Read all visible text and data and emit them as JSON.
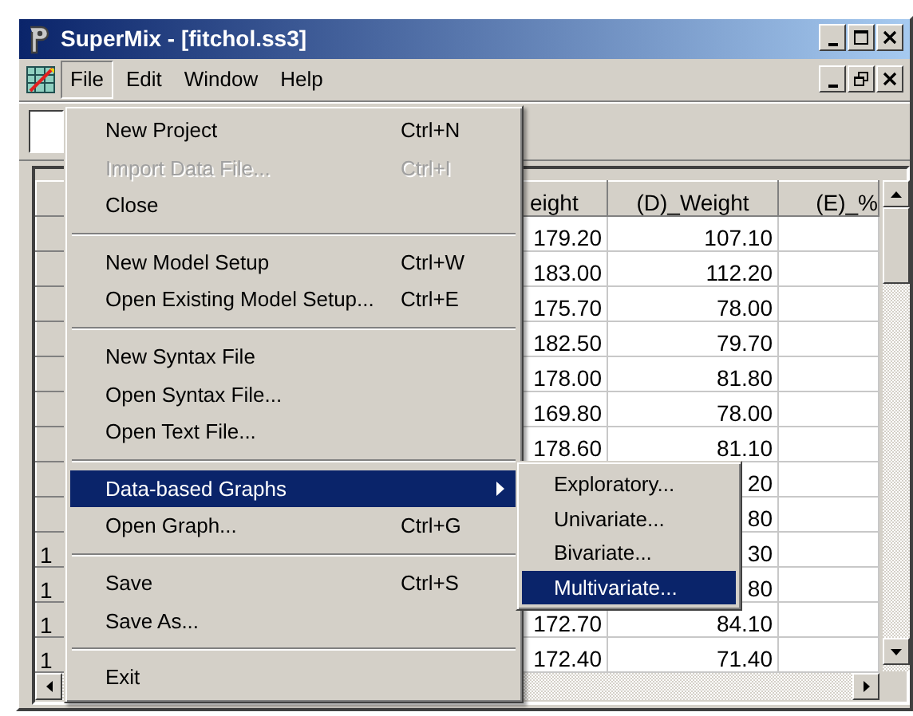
{
  "window": {
    "title": "SuperMix - [fitchol.ss3]"
  },
  "menu_bar": [
    {
      "label": "File",
      "selected": true
    },
    {
      "label": "Edit",
      "selected": false
    },
    {
      "label": "Window",
      "selected": false
    },
    {
      "label": "Help",
      "selected": false
    }
  ],
  "grid": {
    "columns": [
      "eight",
      "(D)_Weight",
      "(E)_%"
    ],
    "rows": [
      {
        "header": "",
        "cells": [
          "179.20",
          "107.10",
          ""
        ]
      },
      {
        "header": "",
        "cells": [
          "183.00",
          "112.20",
          ""
        ]
      },
      {
        "header": "",
        "cells": [
          "175.70",
          "78.00",
          ""
        ]
      },
      {
        "header": "",
        "cells": [
          "182.50",
          "79.70",
          ""
        ]
      },
      {
        "header": "",
        "cells": [
          "178.00",
          "81.80",
          ""
        ]
      },
      {
        "header": "",
        "cells": [
          "169.80",
          "78.00",
          ""
        ]
      },
      {
        "header": "",
        "cells": [
          "178.60",
          "81.10",
          ""
        ]
      },
      {
        "header": "",
        "cells": [
          "",
          "20",
          ""
        ]
      },
      {
        "header": "",
        "cells": [
          "",
          "80",
          ""
        ]
      },
      {
        "header": "1",
        "cells": [
          "",
          "30",
          ""
        ]
      },
      {
        "header": "1",
        "cells": [
          "",
          "80",
          ""
        ]
      },
      {
        "header": "1",
        "cells": [
          "172.70",
          "84.10",
          ""
        ]
      },
      {
        "header": "1",
        "cells": [
          "172.40",
          "71.40",
          ""
        ]
      }
    ]
  },
  "file_menu": [
    {
      "kind": "item",
      "label": "New Project",
      "shortcut": "Ctrl+N",
      "disabled": false,
      "selected": false
    },
    {
      "kind": "item",
      "label": "Import Data File...",
      "shortcut": "Ctrl+I",
      "disabled": true,
      "selected": false
    },
    {
      "kind": "item",
      "label": "Close",
      "disabled": false,
      "selected": false
    },
    {
      "kind": "separator"
    },
    {
      "kind": "item",
      "label": "New Model Setup",
      "shortcut": "Ctrl+W",
      "disabled": false,
      "selected": false
    },
    {
      "kind": "item",
      "label": "Open Existing Model Setup...",
      "shortcut": "Ctrl+E",
      "disabled": false,
      "selected": false
    },
    {
      "kind": "separator"
    },
    {
      "kind": "item",
      "label": "New Syntax File",
      "disabled": false,
      "selected": false
    },
    {
      "kind": "item",
      "label": "Open Syntax File...",
      "disabled": false,
      "selected": false
    },
    {
      "kind": "item",
      "label": "Open Text File...",
      "disabled": false,
      "selected": false
    },
    {
      "kind": "separator"
    },
    {
      "kind": "submenu",
      "label": "Data-based Graphs",
      "disabled": false,
      "selected": true
    },
    {
      "kind": "item",
      "label": "Open Graph...",
      "shortcut": "Ctrl+G",
      "disabled": false,
      "selected": false
    },
    {
      "kind": "separator"
    },
    {
      "kind": "item",
      "label": "Save",
      "shortcut": "Ctrl+S",
      "disabled": false,
      "selected": false
    },
    {
      "kind": "item",
      "label": "Save As...",
      "disabled": false,
      "selected": false
    },
    {
      "kind": "separator"
    },
    {
      "kind": "item",
      "label": "Exit",
      "disabled": false,
      "selected": false
    }
  ],
  "graphs_submenu": [
    {
      "label": "Exploratory...",
      "selected": false
    },
    {
      "label": "Univariate...",
      "selected": false
    },
    {
      "label": "Bivariate...",
      "selected": false
    },
    {
      "label": "Multivariate...",
      "selected": true
    }
  ]
}
